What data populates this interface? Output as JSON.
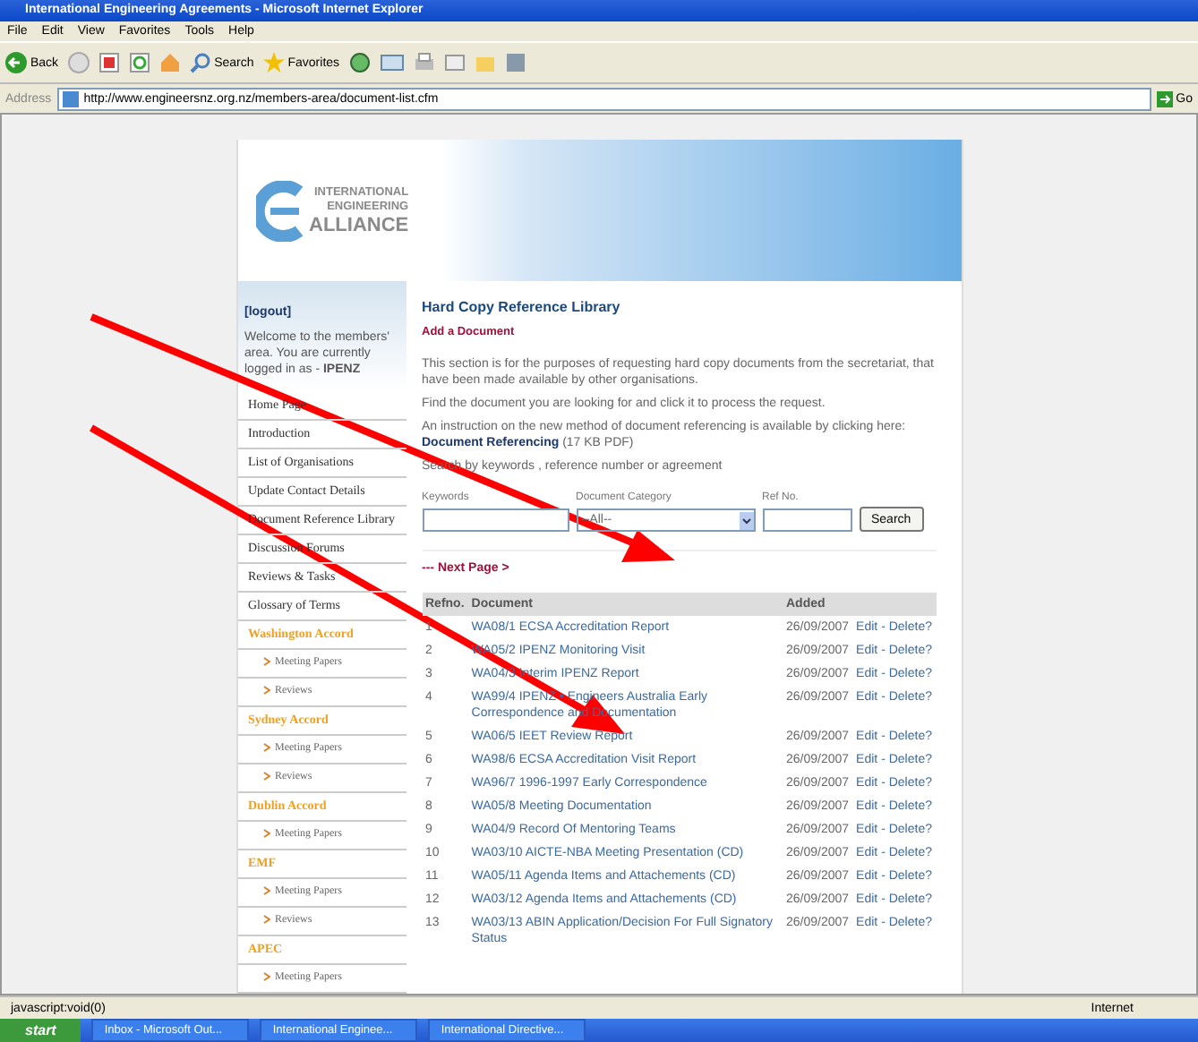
{
  "window": {
    "title": "International Engineering Agreements - Microsoft Internet Explorer"
  },
  "menu": [
    "File",
    "Edit",
    "View",
    "Favorites",
    "Tools",
    "Help"
  ],
  "toolbar": {
    "back": "Back",
    "search": "Search",
    "favorites": "Favorites"
  },
  "address": {
    "label": "Address",
    "url": "http://www.engineersnz.org.nz/members-area/document-list.cfm",
    "go": "Go"
  },
  "logo": {
    "line1": "INTERNATIONAL",
    "line2": "ENGINEERING",
    "line3": "ALLIANCE"
  },
  "sidebar": {
    "logout": "[logout]",
    "welcome": "Welcome to the members' area. You are currently logged in as - **IPENZ**",
    "items": [
      {
        "kind": "link",
        "label": "Home Page"
      },
      {
        "kind": "link",
        "label": "Introduction"
      },
      {
        "kind": "link",
        "label": "List of Organisations"
      },
      {
        "kind": "link",
        "label": "Update Contact Details"
      },
      {
        "kind": "link",
        "label": "Document Reference Library"
      },
      {
        "kind": "link",
        "label": "Discussion Forums"
      },
      {
        "kind": "link",
        "label": "Reviews & Tasks"
      },
      {
        "kind": "link",
        "label": "Glossary of Terms"
      },
      {
        "kind": "section",
        "label": "Washington Accord"
      },
      {
        "kind": "sub",
        "label": "Meeting Papers"
      },
      {
        "kind": "sub",
        "label": "Reviews"
      },
      {
        "kind": "section",
        "label": "Sydney Accord"
      },
      {
        "kind": "sub",
        "label": "Meeting Papers"
      },
      {
        "kind": "sub",
        "label": "Reviews"
      },
      {
        "kind": "section",
        "label": "Dublin Accord"
      },
      {
        "kind": "sub",
        "label": "Meeting Papers"
      },
      {
        "kind": "section",
        "label": "EMF"
      },
      {
        "kind": "sub",
        "label": "Meeting Papers"
      },
      {
        "kind": "sub",
        "label": "Reviews"
      },
      {
        "kind": "section",
        "label": "APEC"
      },
      {
        "kind": "sub",
        "label": "Meeting Papers"
      }
    ]
  },
  "main": {
    "title": "Hard Copy Reference Library",
    "add": "Add a Document",
    "intro": "This section is for the purposes of requesting hard copy documents from the secretariat, that have been made available by other organisations.",
    "find": "Find the document you are looking for and click it to process the request.",
    "instruction": "An instruction on the new method of document referencing is available by clicking here:",
    "ref_link": "Document Referencing",
    "ref_size": " (17 KB PDF)",
    "search_by": "Search by keywords , reference number or agreement",
    "fields": {
      "keywords": "Keywords",
      "category": "Document Category",
      "category_value": "--All--",
      "refno": "Ref No.",
      "button": "Search"
    },
    "next": "--- Next Page >"
  },
  "table": {
    "columns": [
      "Refno.",
      "Document",
      "Added"
    ],
    "rows": [
      {
        "no": "1",
        "doc": "WA08/1 ECSA Accreditation Report",
        "added": "26/09/2007",
        "edit": "Edit",
        "sep": "-",
        "del": "Delete?"
      },
      {
        "no": "2",
        "doc": "WA05/2 IPENZ Monitoring Visit",
        "added": "26/09/2007",
        "edit": "Edit",
        "sep": "-",
        "del": "Delete?"
      },
      {
        "no": "3",
        "doc": "WA04/3 Interim IPENZ Report",
        "added": "26/09/2007",
        "edit": "Edit",
        "sep": "-",
        "del": "Delete?"
      },
      {
        "no": "4",
        "doc": "WA99/4 IPENZ • Engineers Australia Early Correspondence and Documentation",
        "added": "26/09/2007",
        "edit": "Edit",
        "sep": "-",
        "del": "Delete?"
      },
      {
        "no": "5",
        "doc": "WA06/5 IEET Review Report",
        "added": "26/09/2007",
        "edit": "Edit",
        "sep": "-",
        "del": "Delete?"
      },
      {
        "no": "6",
        "doc": "WA98/6 ECSA Accreditation Visit Report",
        "added": "26/09/2007",
        "edit": "Edit",
        "sep": "-",
        "del": "Delete?"
      },
      {
        "no": "7",
        "doc": "WA96/7 1996-1997 Early Correspondence",
        "added": "26/09/2007",
        "edit": "Edit",
        "sep": "-",
        "del": "Delete?"
      },
      {
        "no": "8",
        "doc": "WA05/8 Meeting Documentation",
        "added": "26/09/2007",
        "edit": "Edit",
        "sep": "-",
        "del": "Delete?"
      },
      {
        "no": "9",
        "doc": "WA04/9 Record Of Mentoring Teams",
        "added": "26/09/2007",
        "edit": "Edit",
        "sep": "-",
        "del": "Delete?"
      },
      {
        "no": "10",
        "doc": "WA03/10 AICTE-NBA Meeting Presentation (CD)",
        "added": "26/09/2007",
        "edit": "Edit",
        "sep": "-",
        "del": "Delete?"
      },
      {
        "no": "11",
        "doc": "WA05/11 Agenda Items and Attachements (CD)",
        "added": "26/09/2007",
        "edit": "Edit",
        "sep": "-",
        "del": "Delete?"
      },
      {
        "no": "12",
        "doc": "WA03/12 Agenda Items and Attachements (CD)",
        "added": "26/09/2007",
        "edit": "Edit",
        "sep": "-",
        "del": "Delete?"
      },
      {
        "no": "13",
        "doc": "WA03/13 ABIN Application/Decision For Full Signatory Status",
        "added": "26/09/2007",
        "edit": "Edit",
        "sep": "-",
        "del": "Delete?"
      }
    ]
  },
  "status_bar": {
    "text": "javascript:void(0)",
    "zone": "Internet"
  },
  "taskbar": {
    "start": "start",
    "tasks": [
      "Inbox - Microsoft Out...",
      "International Enginee...",
      "International Directive..."
    ]
  }
}
